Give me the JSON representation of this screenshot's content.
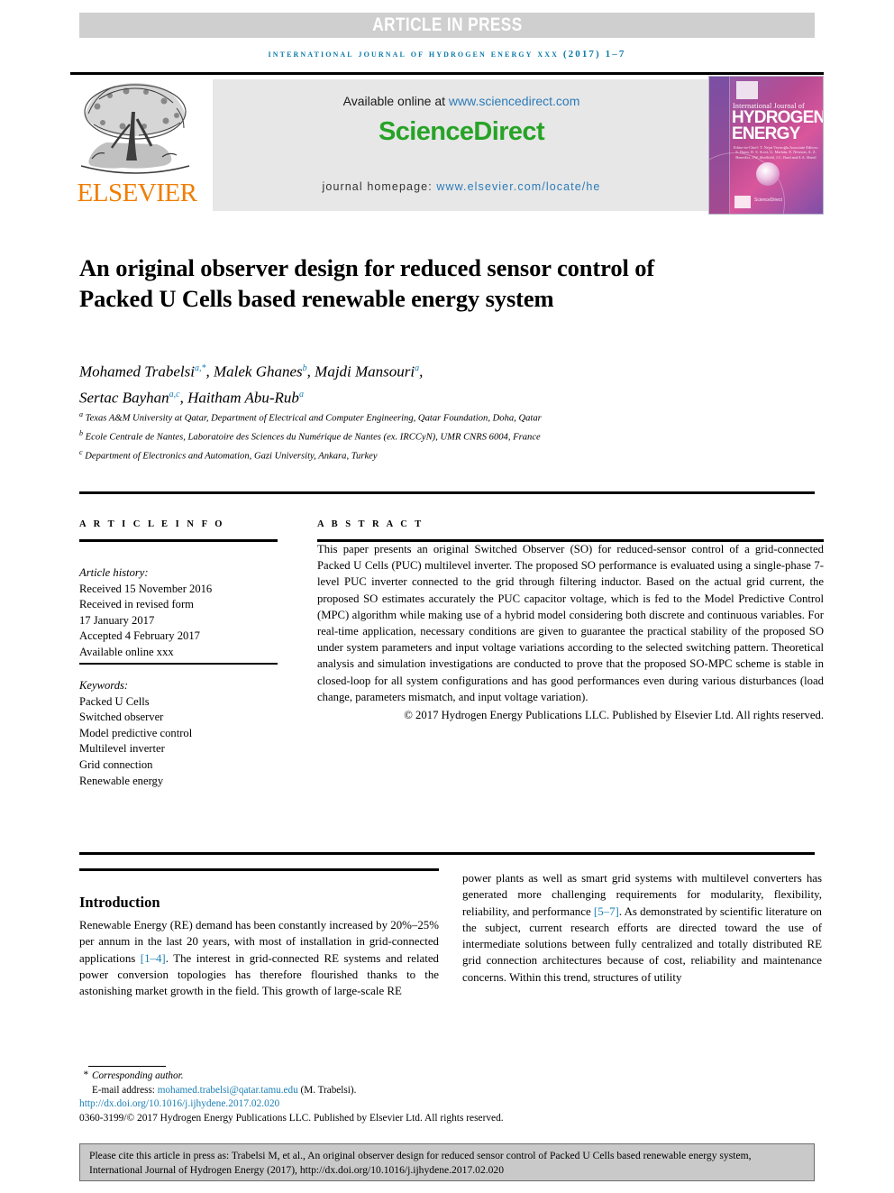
{
  "banner": {
    "text": "ARTICLE IN PRESS",
    "bg": "#cfcfcf",
    "fg": "#ffffff"
  },
  "running_head": "International Journal of Hydrogen Energy xxx (2017) 1–7",
  "masthead": {
    "publisher": "ELSEVIER",
    "publisher_color": "#f07d00",
    "available_prefix": "Available online at ",
    "available_url": "www.sciencedirect.com",
    "sciencedirect": "ScienceDirect",
    "sciencedirect_color": "#27a327",
    "homepage_label": "journal homepage: ",
    "homepage_url": "www.elsevier.com/locate/he",
    "cover": {
      "line1": "International Journal of",
      "line2": "HYDROGEN",
      "line3": "ENERGY",
      "editors": "Editor-in-Chief: T. Nejat Veziroğlu  Associate Editors: S. Dunn, D. S. Scott, G. Marbán, E. Newson, A. Z. Benedict, J.W. Sheffield, J.C. Bard and S.A. Sherif",
      "sciencedirect": "ScienceDirect"
    }
  },
  "article": {
    "title": "An original observer design for reduced sensor control of Packed U Cells based renewable energy system",
    "authors": [
      {
        "name": "Mohamed Trabelsi",
        "marks": "a,*"
      },
      {
        "name": "Malek Ghanes",
        "marks": "b"
      },
      {
        "name": "Majdi Mansouri",
        "marks": "a"
      },
      {
        "name": "Sertac Bayhan",
        "marks": "a,c"
      },
      {
        "name": "Haitham Abu-Rub",
        "marks": "a"
      }
    ],
    "affiliations": [
      {
        "mark": "a",
        "text": "Texas A&M University at Qatar, Department of Electrical and Computer Engineering, Qatar Foundation, Doha, Qatar"
      },
      {
        "mark": "b",
        "text": "Ecole Centrale de Nantes, Laboratoire des Sciences du Numérique de Nantes (ex. IRCCyN), UMR CNRS 6004, France"
      },
      {
        "mark": "c",
        "text": "Department of Electronics and Automation, Gazi University, Ankara, Turkey"
      }
    ]
  },
  "article_info": {
    "heading": "A R T I C L E  I N F O",
    "history_label": "Article history:",
    "history": [
      "Received 15 November 2016",
      "Received in revised form",
      "17 January 2017",
      "Accepted 4 February 2017",
      "Available online xxx"
    ],
    "keywords_label": "Keywords:",
    "keywords": [
      "Packed U Cells",
      "Switched observer",
      "Model predictive control",
      "Multilevel inverter",
      "Grid connection",
      "Renewable energy"
    ]
  },
  "abstract": {
    "heading": "A B S T R A C T",
    "body": "This paper presents an original Switched Observer (SO) for reduced-sensor control of a grid-connected Packed U Cells (PUC) multilevel inverter. The proposed SO performance is evaluated using a single-phase 7-level PUC inverter connected to the grid through filtering inductor. Based on the actual grid current, the proposed SO estimates accurately the PUC capacitor voltage, which is fed to the Model Predictive Control (MPC) algorithm while making use of a hybrid model considering both discrete and continuous variables. For real-time application, necessary conditions are given to guarantee the practical stability of the proposed SO under system parameters and input voltage variations according to the selected switching pattern. Theoretical analysis and simulation investigations are conducted to prove that the proposed SO-MPC scheme is stable in closed-loop for all system configurations and has good performances even during various disturbances (load change, parameters mismatch, and input voltage variation).",
    "copyright": "© 2017 Hydrogen Energy Publications LLC. Published by Elsevier Ltd. All rights reserved."
  },
  "body": {
    "intro_heading": "Introduction",
    "left_pre": "Renewable Energy (RE) demand has been constantly increased by 20%–25% per annum in the last 20 years, with most of installation in grid-connected applications ",
    "left_ref": "[1–4]",
    "left_post": ". The interest in grid-connected RE systems and related power conversion topologies has therefore flourished thanks to the astonishing market growth in the field. This growth of large-scale RE",
    "right_pre": "power plants as well as smart grid systems with multilevel converters has generated more challenging requirements for modularity, flexibility, reliability, and performance ",
    "right_ref": "[5–7]",
    "right_post": ". As demonstrated by scientific literature on the subject, current research efforts are directed toward the use of intermediate solutions between fully centralized and totally distributed RE grid connection architectures because of cost, reliability and maintenance concerns. Within this trend, structures of utility"
  },
  "footnote": {
    "corresponding": "Corresponding author.",
    "email_label": "E-mail address: ",
    "email": "mohamed.trabelsi@qatar.tamu.edu",
    "email_suffix": " (M. Trabelsi).",
    "doi": "http://dx.doi.org/10.1016/j.ijhydene.2017.02.020",
    "issn": "0360-3199/© 2017 Hydrogen Energy Publications LLC. Published by Elsevier Ltd. All rights reserved."
  },
  "cite_box": {
    "text": "Please cite this article in press as: Trabelsi M, et al., An original observer design for reduced sensor control of Packed U Cells based renewable energy system, International Journal of Hydrogen Energy (2017), http://dx.doi.org/10.1016/j.ijhydene.2017.02.020"
  }
}
